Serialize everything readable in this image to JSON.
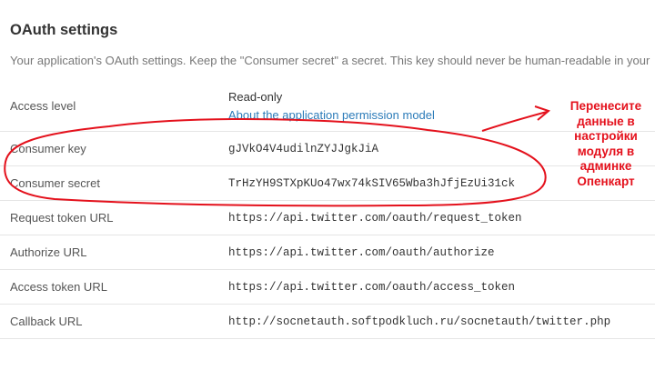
{
  "section": {
    "title": "OAuth settings",
    "description": "Your application's OAuth settings. Keep the \"Consumer secret\" a secret. This key should never be human-readable in your"
  },
  "settings": {
    "access_level": {
      "label": "Access level",
      "value": "Read-only",
      "link_text": "About the application permission model"
    },
    "consumer_key": {
      "label": "Consumer key",
      "value": "gJVkO4V4udilnZYJJgkJiA"
    },
    "consumer_secret": {
      "label": "Consumer secret",
      "value": "TrHzYH9STXpKUo47wx74kSIV65Wba3hJfjEzUi31ck"
    },
    "request_token_url": {
      "label": "Request token URL",
      "value": "https://api.twitter.com/oauth/request_token"
    },
    "authorize_url": {
      "label": "Authorize URL",
      "value": "https://api.twitter.com/oauth/authorize"
    },
    "access_token_url": {
      "label": "Access token URL",
      "value": "https://api.twitter.com/oauth/access_token"
    },
    "callback_url": {
      "label": "Callback URL",
      "value": "http://socnetauth.softpodkluch.ru/socnetauth/twitter.php"
    }
  },
  "annotation": {
    "text": "Перенесите\nданные в\nнастройки\nмодуля в\nадминке\nОпенкарт",
    "color": "#e4111c"
  }
}
